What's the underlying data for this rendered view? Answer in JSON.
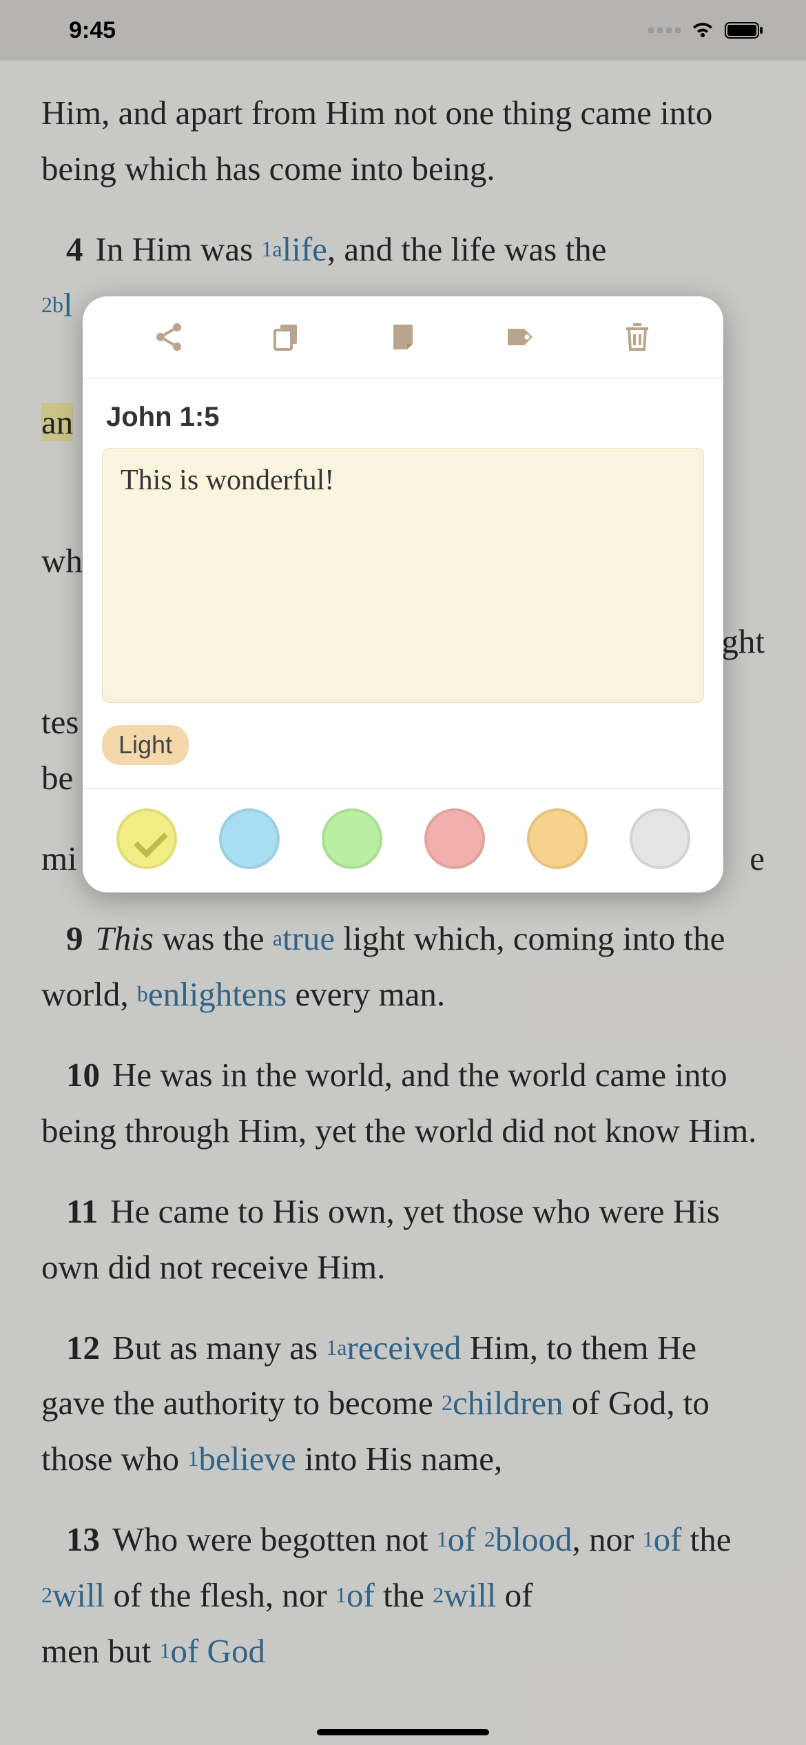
{
  "status": {
    "time": "9:45"
  },
  "bible": {
    "prefix_text": "Him, and apart from Him not one thing came into being which has come into being.",
    "v4": {
      "num": "4",
      "t1": "In Him was ",
      "ref1": "1a",
      "link1": "life",
      "t2": ", and the life was the ",
      "ref2": "2b",
      "trail_fragment": "l"
    },
    "v5_frag_left": "an",
    "frag_wh": "wh",
    "frag_ght": "ght",
    "frag_tes": "tes",
    "frag_be": "be",
    "frag_mi": "mi",
    "frag_e": "e",
    "v9": {
      "num": "9",
      "t1": "This",
      "t2": " was the ",
      "refa": "a",
      "link1": "true",
      "t3": " light which, coming into the world, ",
      "refb": "b",
      "link2": "enlightens",
      "t4": " every man."
    },
    "v10": {
      "num": "10",
      "text": "He was in the world, and the world came into being through Him, yet the world did not know Him."
    },
    "v11": {
      "num": "11",
      "text": "He came to His own, yet those who were His own did not receive Him."
    },
    "v12": {
      "num": "12",
      "t1": "But as many as ",
      "ref1": "1a",
      "link1": "received",
      "t2": " Him, to them He gave the authority to become ",
      "ref2": "2",
      "link2": "children",
      "t3": " of God, to those who ",
      "ref3": "1",
      "link3": "believe",
      "t4": " into His name,"
    },
    "v13": {
      "num": "13",
      "t1": "Who were begotten not ",
      "ref1": "1",
      "link1": "of",
      "ref1b": "2",
      "link1b": "blood",
      "t2": ", nor ",
      "ref2": "1",
      "link2": "of",
      "t3": " the ",
      "ref2b": "2",
      "link2b": "will",
      "t4": " of the flesh, nor ",
      "ref3": "1",
      "link3": "of",
      "t5": " the ",
      "ref3b": "2",
      "link3b": "will",
      "t6": " of",
      "partial": "men  but ",
      "ref4": "1",
      "link4": "of God"
    }
  },
  "popup": {
    "verse_ref": "John 1:5",
    "note_text": "This is wonderful!",
    "tag": "Light",
    "colors": [
      {
        "name": "yellow",
        "hex": "#f2ee85",
        "selected": true
      },
      {
        "name": "blue",
        "hex": "#a8def2",
        "selected": false
      },
      {
        "name": "green",
        "hex": "#b8efa0",
        "selected": false
      },
      {
        "name": "red",
        "hex": "#f2b0ac",
        "selected": false
      },
      {
        "name": "orange",
        "hex": "#f6d28c",
        "selected": false
      },
      {
        "name": "gray",
        "hex": "#e4e4e4",
        "selected": false
      }
    ]
  }
}
